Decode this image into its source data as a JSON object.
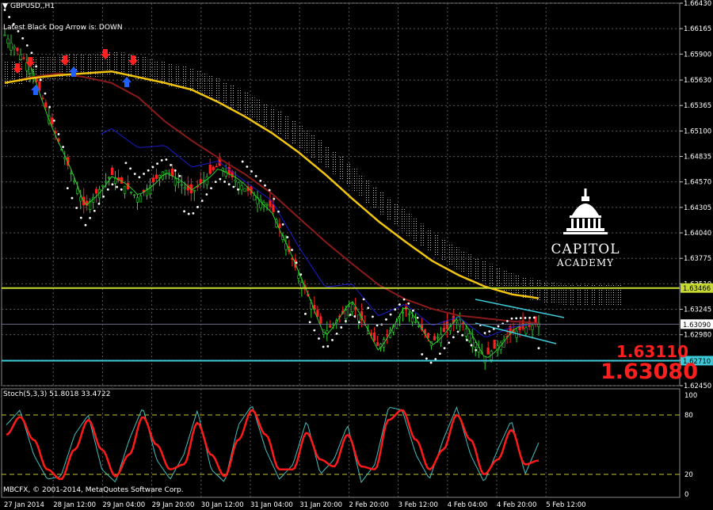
{
  "header": {
    "symbol_title": "GBPUSD,,H1",
    "indicator_note": "Latest Black Dog Arrow is:  DOWN"
  },
  "stoch": {
    "label": "Stoch(5,3,3) 51.8018 33.4722"
  },
  "footer": {
    "copyright": "MBCFX, © 2001-2014, MetaQuotes Software Corp."
  },
  "logo": {
    "line1": "CAPITOL",
    "line2": "ACADEMY"
  },
  "prices": {
    "bid": "1.63110",
    "ask": "1.63080"
  },
  "colors": {
    "background": "#000000",
    "grid": "#5a5a5a",
    "candles": "#ff2020",
    "ma_slow": "#f2c50f",
    "ma_mid": "#8b1a1a",
    "fast_line": "#1a1ad0",
    "green_line": "#2bd12b",
    "cloud_dots": "#c8c8c8",
    "stoch_main": "#ff1a1a",
    "stoch_signal": "#40c0c0",
    "level_yellow": "#c6d932",
    "level_cyan": "#3ec9d8"
  },
  "chart_data": [
    {
      "type": "line",
      "title": "GBPUSD,,H1",
      "ylim": [
        1.6245,
        1.6643
      ],
      "y_ticks": [
        "1.66430",
        "1.66165",
        "1.65900",
        "1.65630",
        "1.65365",
        "1.65100",
        "1.64835",
        "1.64570",
        "1.64305",
        "1.64040",
        "1.63775",
        "1.63510",
        "1.63245",
        "1.62980",
        "1.62715",
        "1.62450"
      ],
      "x_ticks": [
        "27 Jan 2014",
        "28 Jan 12:00",
        "29 Jan 04:00",
        "29 Jan 20:00",
        "30 Jan 12:00",
        "31 Jan 04:00",
        "31 Jan 20:00",
        "2 Feb 20:00",
        "3 Feb 12:00",
        "4 Feb 04:00",
        "4 Feb 20:00",
        "5 Feb 12:00"
      ],
      "price_tags": [
        {
          "value": 1.63466,
          "label": "1.63466",
          "role": "resistance"
        },
        {
          "value": 1.6309,
          "label": "1.63090",
          "role": "current"
        },
        {
          "value": 1.6271,
          "label": "1.62710",
          "role": "support"
        }
      ],
      "series": [
        {
          "values": [
            1.656,
            1.6565,
            1.6568,
            1.657,
            1.6572,
            1.6566,
            1.656,
            1.6553,
            1.654,
            1.6525,
            1.6508,
            1.6488,
            1.6465,
            1.644,
            1.6416,
            1.6395,
            1.6375,
            1.636,
            1.6348,
            1.634,
            1.6336
          ]
        },
        {
          "values": [
            1.656,
            1.6566,
            1.657,
            1.6566,
            1.656,
            1.6545,
            1.652,
            1.65,
            1.6482,
            1.6465,
            1.6445,
            1.642,
            1.6395,
            1.6372,
            1.635,
            1.6335,
            1.6325,
            1.6318,
            1.6315,
            1.6312,
            1.631
          ]
        },
        {
          "values": [
            1.661,
            1.6575,
            1.65,
            1.643,
            1.6465,
            1.644,
            1.647,
            1.6445,
            1.6475,
            1.645,
            1.643,
            1.636,
            1.63,
            1.633,
            1.6285,
            1.6325,
            1.629,
            1.6315,
            1.6275,
            1.63,
            1.631
          ]
        }
      ]
    },
    {
      "type": "line",
      "title": "Stoch(5,3,3) 51.8018 33.4722",
      "ylim": [
        0,
        100
      ],
      "y_ticks": [
        "100",
        "80",
        "20",
        "0"
      ],
      "levels": [
        80,
        20
      ],
      "series": [
        {
          "values": [
            70,
            85,
            40,
            15,
            18,
            60,
            80,
            25,
            12,
            55,
            88,
            35,
            15,
            40,
            85,
            25,
            12,
            70,
            90,
            45,
            15,
            30,
            75,
            20,
            35,
            70,
            12,
            30,
            88,
            85,
            40,
            15,
            55,
            88,
            40,
            12,
            45,
            75,
            20,
            52
          ]
        },
        {
          "values": [
            60,
            78,
            55,
            25,
            15,
            45,
            75,
            45,
            18,
            40,
            78,
            50,
            25,
            30,
            72,
            40,
            18,
            55,
            85,
            60,
            25,
            25,
            62,
            35,
            28,
            60,
            28,
            25,
            75,
            85,
            55,
            25,
            45,
            80,
            55,
            20,
            35,
            65,
            30,
            34
          ]
        }
      ]
    }
  ]
}
